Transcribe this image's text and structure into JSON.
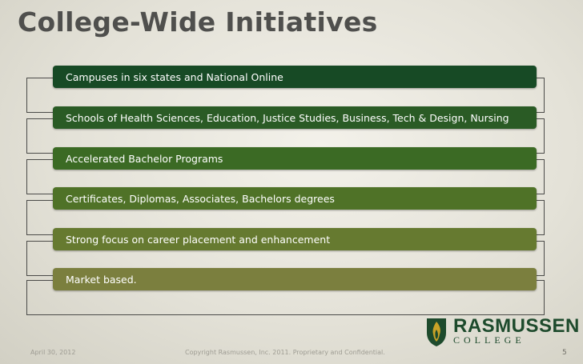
{
  "slide": {
    "title": "College-Wide Initiatives",
    "items": [
      {
        "text": "Campuses in six states and National Online",
        "color": "#174a25"
      },
      {
        "text": "Schools of Health Sciences, Education, Justice Studies, Business, Tech & Design, Nursing",
        "color": "#2a5b25"
      },
      {
        "text": "Accelerated Bachelor Programs",
        "color": "#3b6a24"
      },
      {
        "text": "Certificates, Diplomas, Associates, Bachelors degrees",
        "color": "#4f7227"
      },
      {
        "text": "Strong focus on career placement and enhancement",
        "color": "#667a30"
      },
      {
        "text": "Market based.",
        "color": "#7b7f3e"
      }
    ]
  },
  "logo": {
    "name": "RASMUSSEN",
    "sub": "COLLEGE",
    "icon": "flame-shield-icon",
    "colors": {
      "green": "#1d4a2c",
      "gold": "#c9a227"
    }
  },
  "footer": {
    "date": "April 30, 2012",
    "copyright": "Copyright Rasmussen, Inc. 2011. Proprietary and Confidential.",
    "page_number": "5"
  }
}
